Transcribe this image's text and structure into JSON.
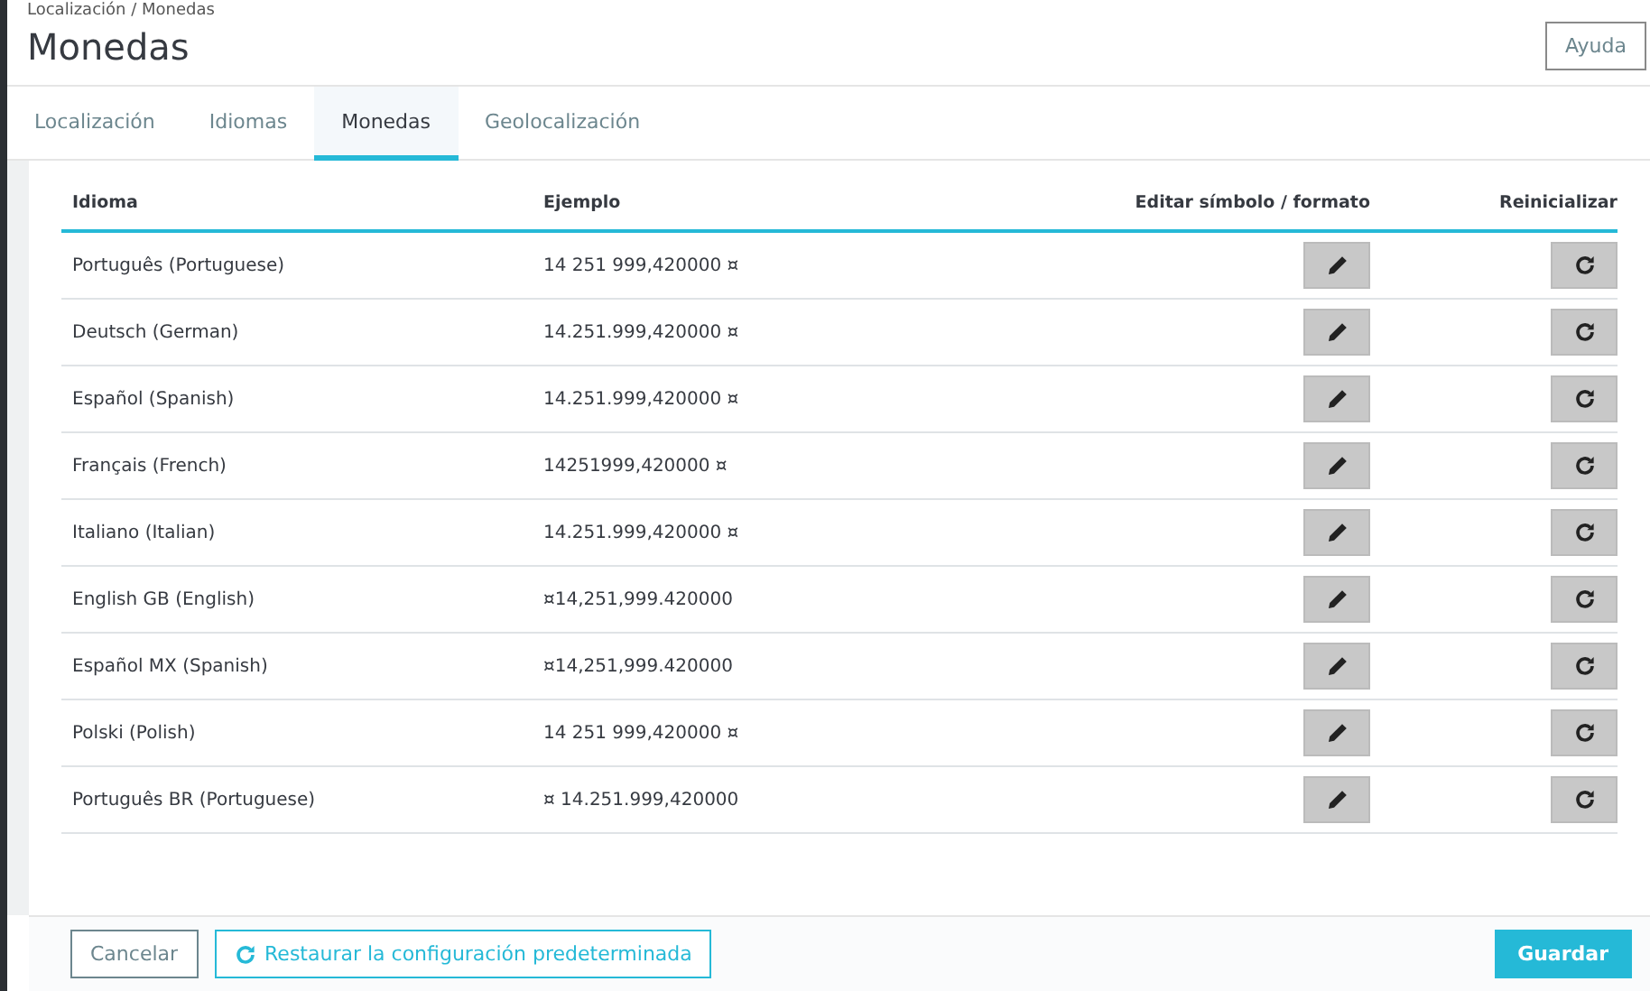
{
  "breadcrumb": "Localización / Monedas",
  "title": "Monedas",
  "help_button": "Ayuda",
  "tabs": [
    {
      "label": "Localización",
      "selected": false
    },
    {
      "label": "Idiomas",
      "selected": false
    },
    {
      "label": "Monedas",
      "selected": true
    },
    {
      "label": "Geolocalización",
      "selected": false
    }
  ],
  "table": {
    "columns": [
      "Idioma",
      "Ejemplo",
      "Editar símbolo / formato",
      "Reinicializar"
    ],
    "rows": [
      {
        "language": "Português (Portuguese)",
        "example": "14 251 999,420000 ¤"
      },
      {
        "language": "Deutsch (German)",
        "example": "14.251.999,420000 ¤"
      },
      {
        "language": "Español (Spanish)",
        "example": "14.251.999,420000 ¤"
      },
      {
        "language": "Français (French)",
        "example": "14251999,420000 ¤"
      },
      {
        "language": "Italiano (Italian)",
        "example": "14.251.999,420000 ¤"
      },
      {
        "language": "English GB (English)",
        "example": "¤14,251,999.420000"
      },
      {
        "language": "Español MX (Spanish)",
        "example": "¤14,251,999.420000"
      },
      {
        "language": "Polski (Polish)",
        "example": "14 251 999,420000 ¤"
      },
      {
        "language": "Português BR (Portuguese)",
        "example": "¤ 14.251.999,420000"
      }
    ]
  },
  "footer": {
    "cancel": "Cancelar",
    "restore": "Restaurar la configuración predeterminada",
    "save": "Guardar"
  }
}
